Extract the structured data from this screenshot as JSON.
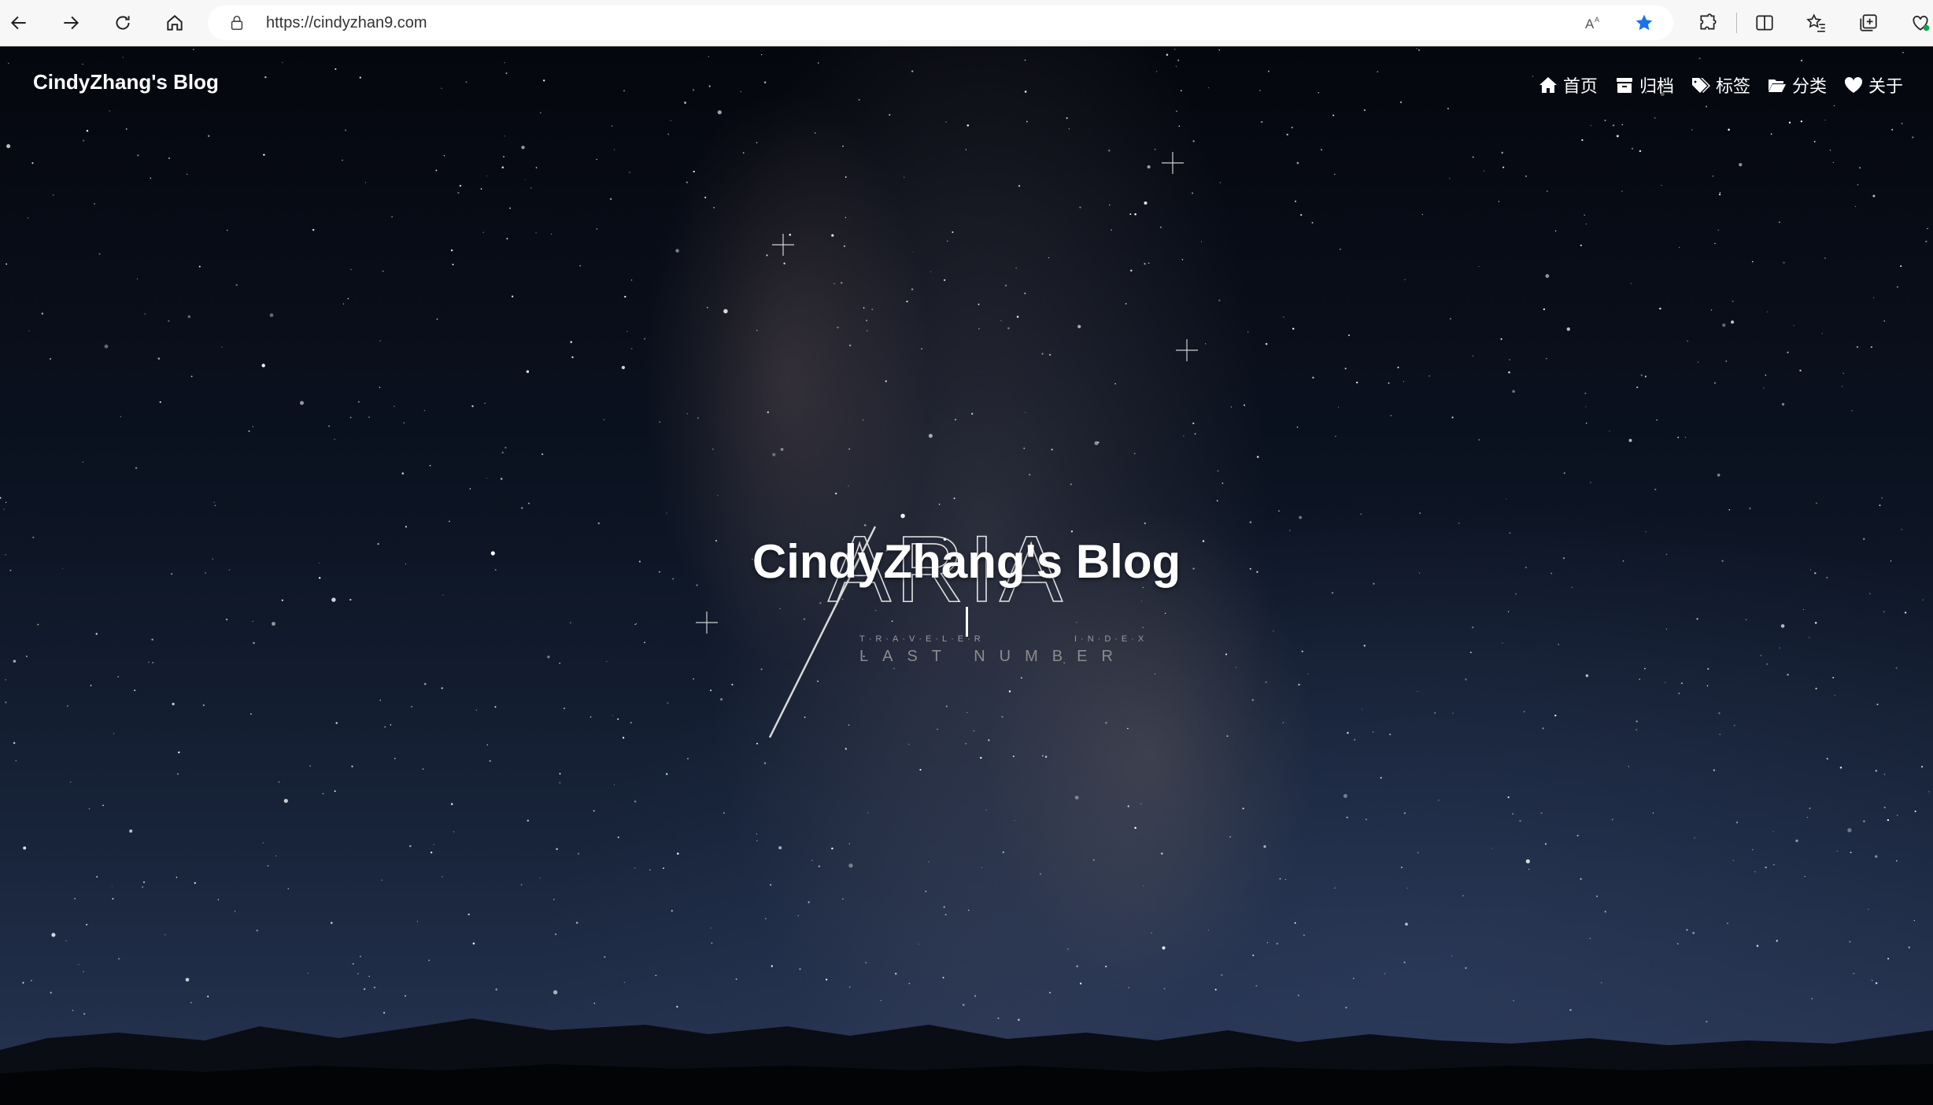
{
  "browser": {
    "url": "https://cindyzhan9.com"
  },
  "site": {
    "brand": "CindyZhang's Blog",
    "menu": [
      {
        "icon": "home-icon",
        "label": "首页"
      },
      {
        "icon": "archive-icon",
        "label": "归档"
      },
      {
        "icon": "tags-icon",
        "label": "标签"
      },
      {
        "icon": "folder-icon",
        "label": "分类"
      },
      {
        "icon": "heart-icon",
        "label": "关于"
      }
    ]
  },
  "hero": {
    "title": "CindyZhang's Blog",
    "logo": {
      "word": "ARIA",
      "left_caption": "T·R·A·V·E·L·E·R",
      "right_caption": "I·N·D·E·X",
      "bottom_caption": "LAST NUMBER"
    }
  },
  "colors": {
    "accent_star": "#1a73e8",
    "sky_top": "#05070e",
    "sky_bottom": "#273552"
  }
}
